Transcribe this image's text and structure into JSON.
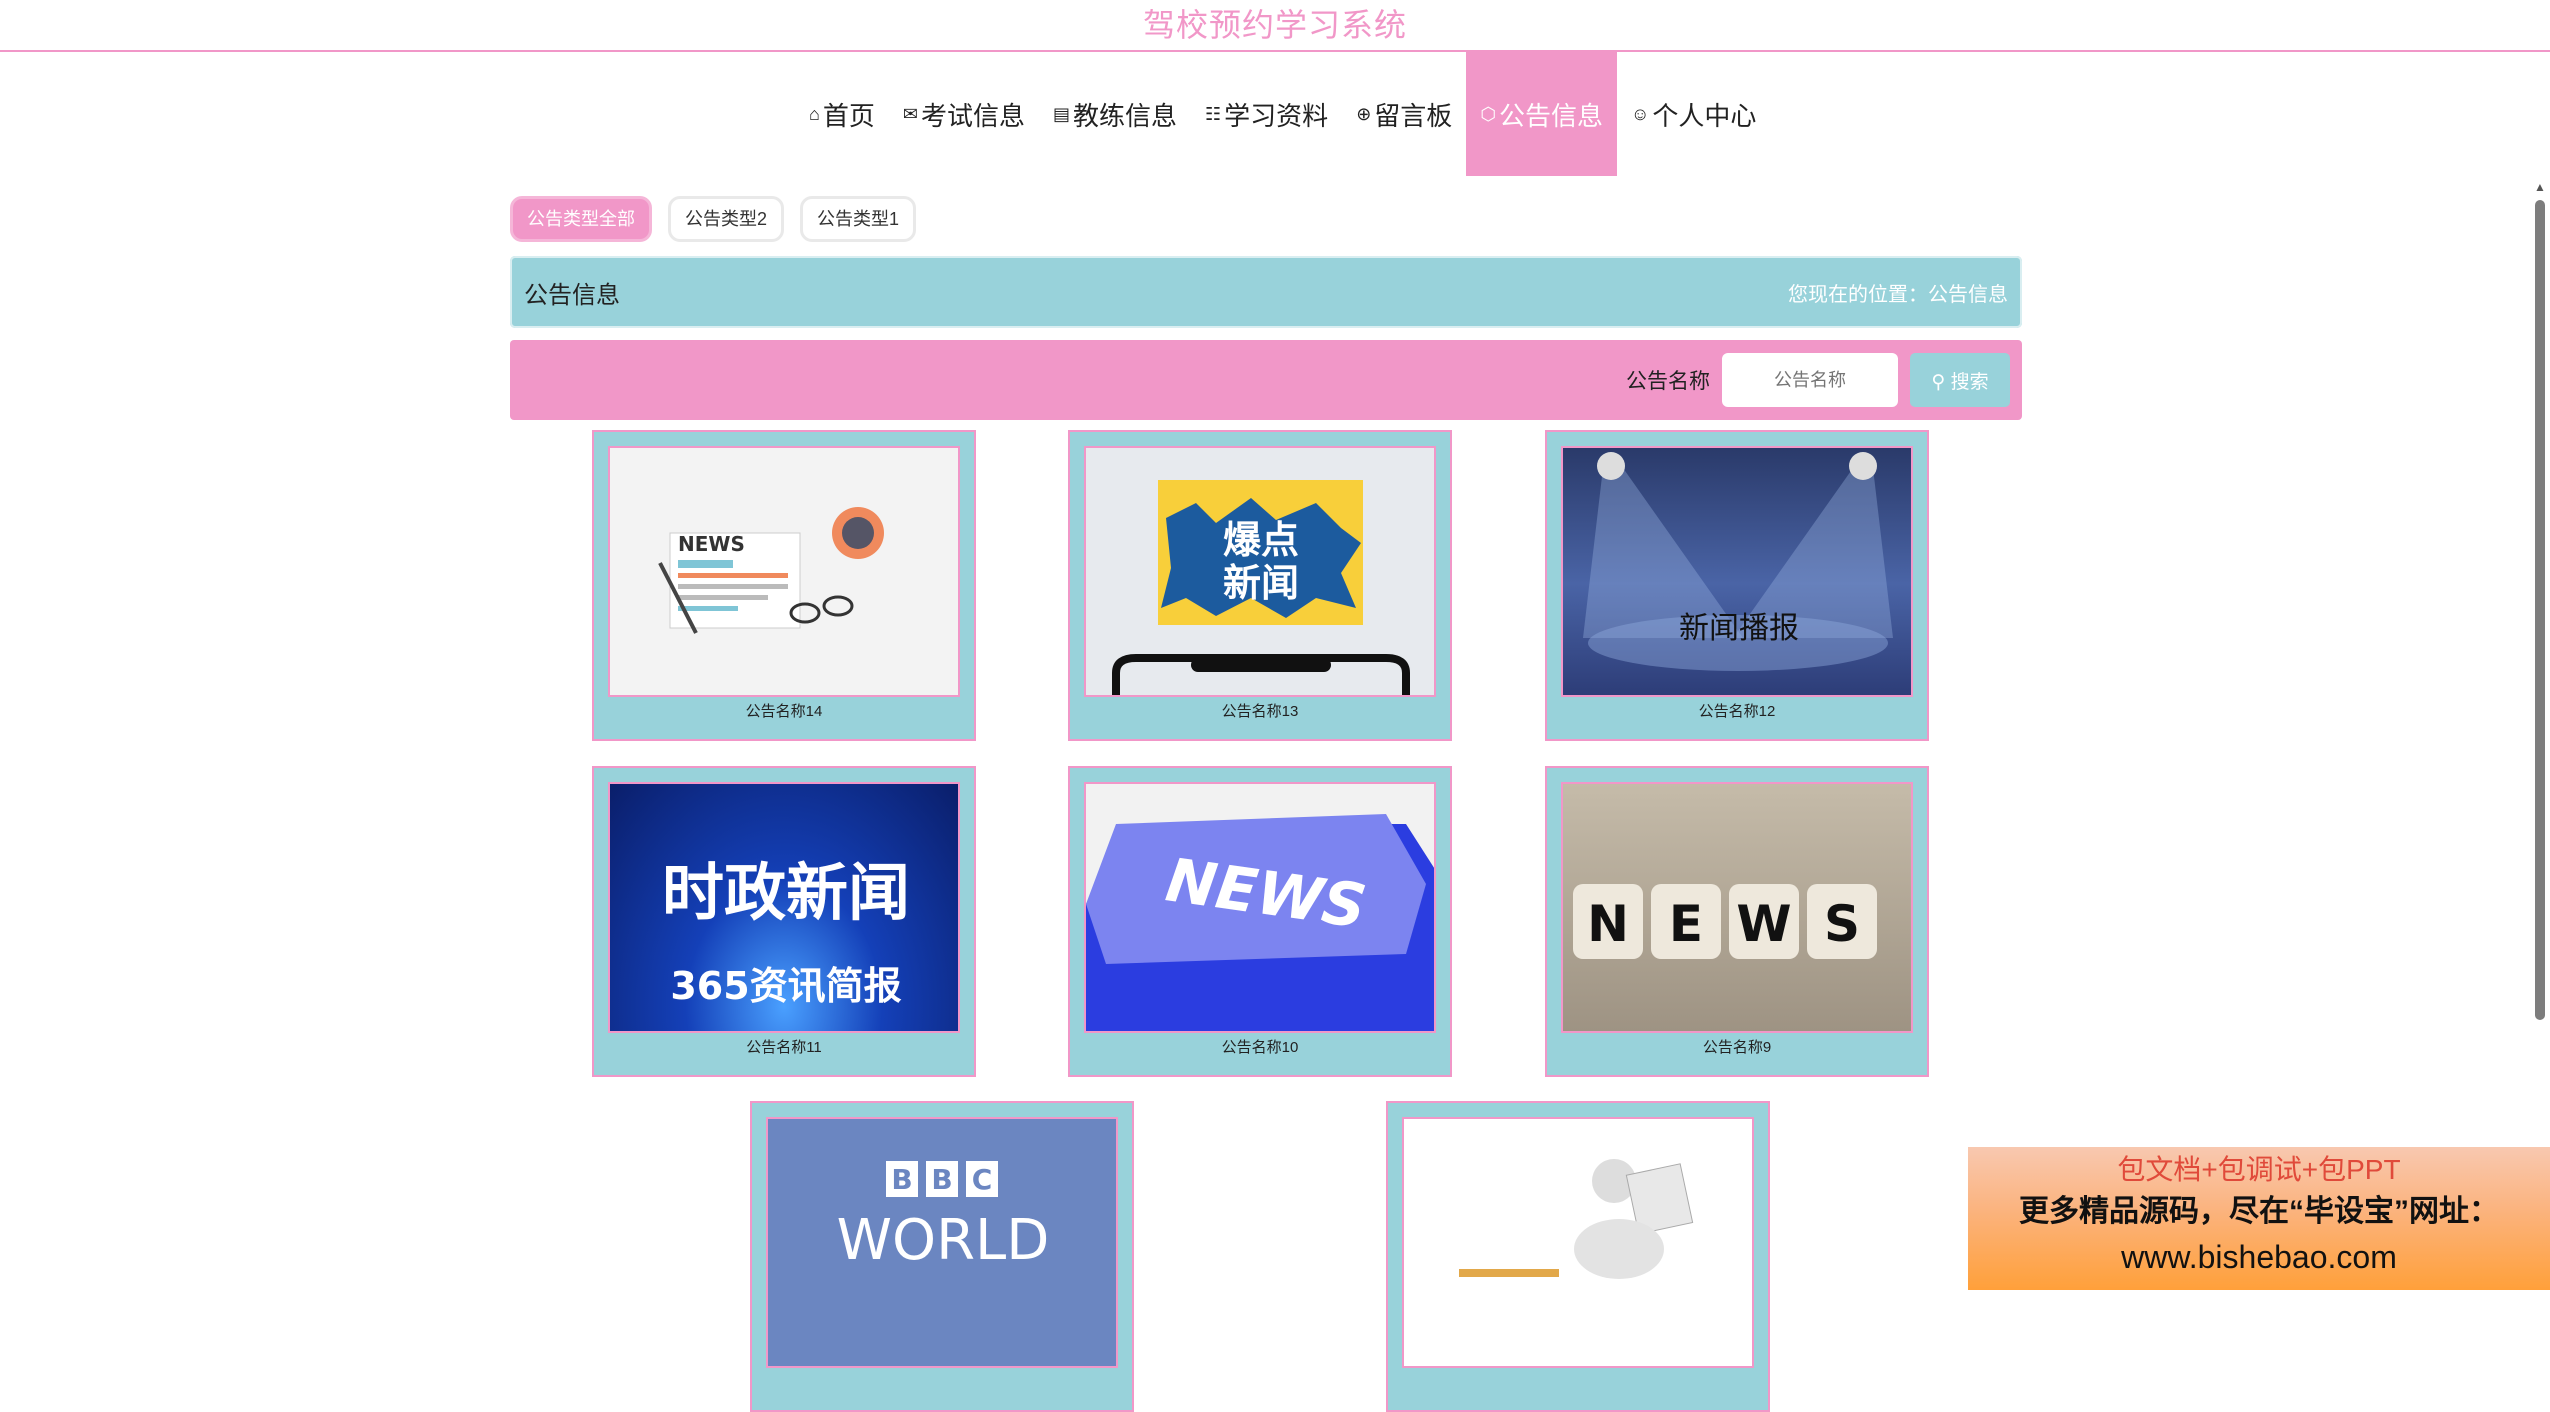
{
  "app": {
    "title": "驾校预约学习系统"
  },
  "nav": {
    "items": [
      {
        "icon": "home-icon",
        "label": "首页"
      },
      {
        "icon": "mail-icon",
        "label": "考试信息"
      },
      {
        "icon": "calendar-icon",
        "label": "教练信息"
      },
      {
        "icon": "grid-icon",
        "label": "学习资料"
      },
      {
        "icon": "globe-icon",
        "label": "留言板"
      },
      {
        "icon": "cube-icon",
        "label": "公告信息",
        "active": true
      },
      {
        "icon": "user-icon",
        "label": "个人中心"
      }
    ]
  },
  "filters": [
    "公告类型全部",
    "公告类型2",
    "公告类型1"
  ],
  "location": {
    "title": "公告信息",
    "breadcrumb": "您现在的位置：公告信息"
  },
  "search": {
    "label": "公告名称",
    "placeholder": "公告名称",
    "button": "搜索"
  },
  "cards": [
    {
      "name": "公告名称14",
      "image_text": "NEWS"
    },
    {
      "name": "公告名称13",
      "image_text": "爆点新闻"
    },
    {
      "name": "公告名称12",
      "image_text": "新闻播报"
    },
    {
      "name": "公告名称11",
      "image_text": "时政新闻 365资讯简报"
    },
    {
      "name": "公告名称10",
      "image_text": "NEWS"
    },
    {
      "name": "公告名称9",
      "image_text": "NEWS"
    },
    {
      "name": "",
      "image_text": "BBC WORLD"
    },
    {
      "name": "",
      "image_text": ""
    }
  ],
  "ad": {
    "line1": "包文档+包调试+包PPT",
    "line2": "更多精品源码，尽在“毕设宝”网址：",
    "line3": "www.bishebao.com"
  },
  "colors": {
    "accent": "#f197c8",
    "teal": "#98d2da"
  }
}
